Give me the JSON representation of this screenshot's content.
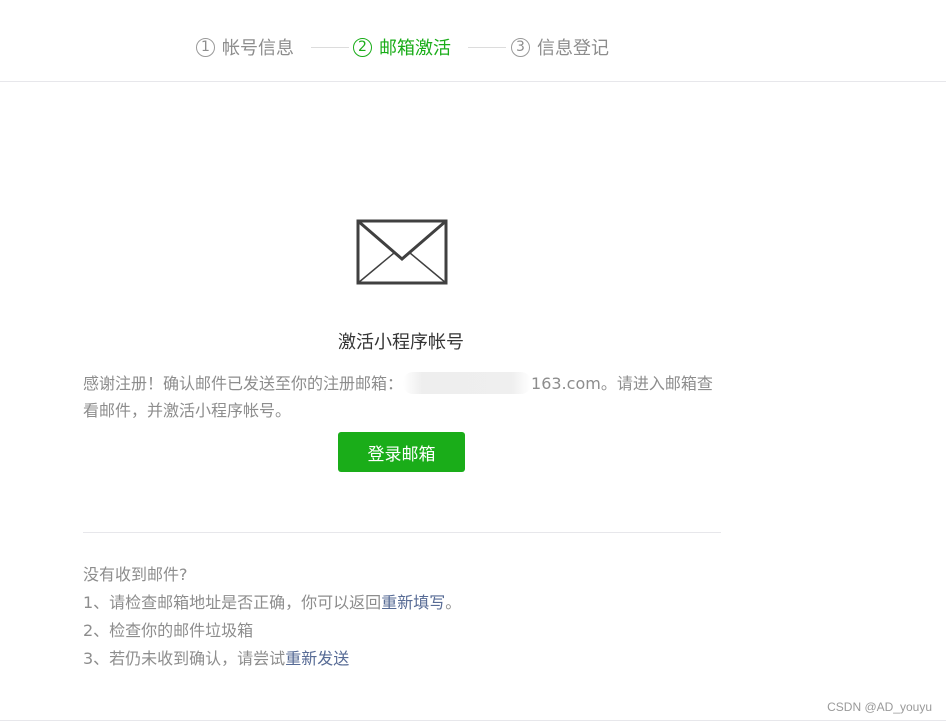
{
  "stepper": {
    "steps": [
      {
        "num": "1",
        "label": "帐号信息"
      },
      {
        "num": "2",
        "label": "邮箱激活"
      },
      {
        "num": "3",
        "label": "信息登记"
      }
    ],
    "active_step": 2
  },
  "main": {
    "icon": "envelope-icon",
    "title": "激活小程序帐号",
    "desc_prefix": "感谢注册！确认邮件已发送至你的注册邮箱：",
    "email_suffix": "163.com",
    "desc_suffix": "。请进入邮箱查看邮件，并激活小程序帐号。",
    "login_button": "登录邮箱"
  },
  "help": {
    "heading": "没有收到邮件?",
    "line1_text": "1、请检查邮箱地址是否正确，你可以返回",
    "line1_link": "重新填写",
    "line1_end": "。",
    "line2_text": "2、检查你的邮件垃圾箱",
    "line3_text": "3、若仍未收到确认，请尝试",
    "line3_link": "重新发送"
  },
  "watermark": "CSDN @AD_youyu",
  "colors": {
    "accent": "#1aad19",
    "link": "#576b95",
    "muted": "#8d8d8d"
  }
}
